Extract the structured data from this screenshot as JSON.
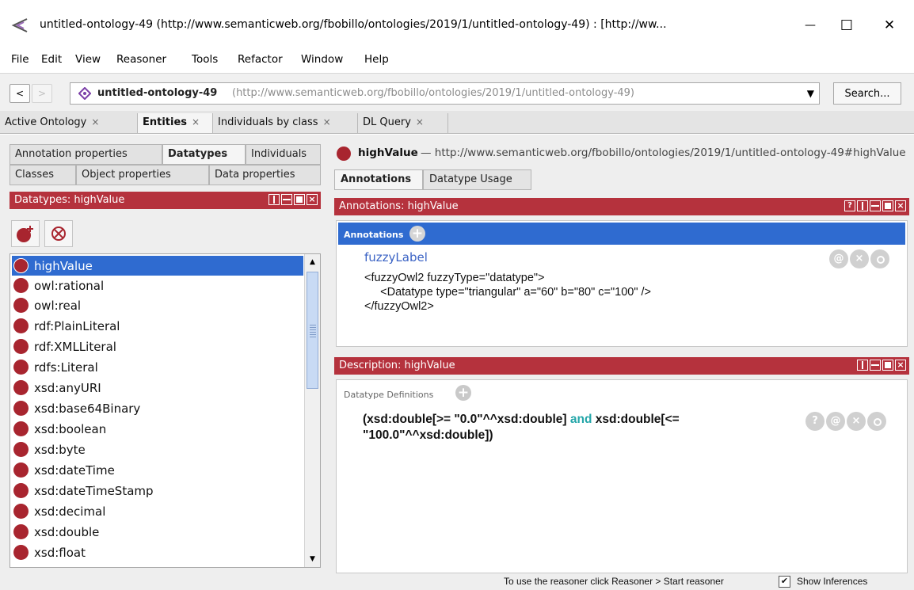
{
  "window": {
    "title": "untitled-ontology-49 (http://www.semanticweb.org/fbobillo/ontologies/2019/1/untitled-ontology-49)  : [http://ww...",
    "minimize_glyph": "—",
    "maximize_glyph": "☐",
    "close_glyph": "✕"
  },
  "menu": [
    "File",
    "Edit",
    "View",
    "Reasoner",
    "Tools",
    "Refactor",
    "Window",
    "Help"
  ],
  "nav": {
    "back": "<",
    "forward": ">",
    "ontology_name": "untitled-ontology-49",
    "ontology_iri": "(http://www.semanticweb.org/fbobillo/ontologies/2019/1/untitled-ontology-49)",
    "dropdown_glyph": "▼",
    "search_label": "Search..."
  },
  "workspace_tabs": [
    {
      "label": "Active Ontology",
      "close": "×",
      "active": false
    },
    {
      "label": "Entities",
      "close": "×",
      "active": true
    },
    {
      "label": "Individuals by class",
      "close": "×",
      "active": false
    },
    {
      "label": "DL Query",
      "close": "×",
      "active": false
    }
  ],
  "entity_tabs": {
    "row1": [
      "Annotation properties",
      "Datatypes",
      "Individuals"
    ],
    "row2": [
      "Classes",
      "Object properties",
      "Data properties"
    ],
    "active": "Datatypes"
  },
  "datatypes_view": {
    "title": "Datatypes: highValue",
    "items": [
      "highValue",
      "owl:rational",
      "owl:real",
      "rdf:PlainLiteral",
      "rdf:XMLLiteral",
      "rdfs:Literal",
      "xsd:anyURI",
      "xsd:base64Binary",
      "xsd:boolean",
      "xsd:byte",
      "xsd:dateTime",
      "xsd:dateTimeStamp",
      "xsd:decimal",
      "xsd:double",
      "xsd:float"
    ],
    "selected": "highValue",
    "scroll_up": "▲",
    "scroll_down": "▼"
  },
  "entity_header": {
    "name": "highValue",
    "iri": "— http://www.semanticweb.org/fbobillo/ontologies/2019/1/untitled-ontology-49#highValue"
  },
  "right_tabs": [
    {
      "label": "Annotations",
      "active": true
    },
    {
      "label": "Datatype Usage",
      "active": false
    }
  ],
  "annotations_view": {
    "title": "Annotations: highValue",
    "header_label": "Annotations",
    "property": "fuzzyLabel",
    "value": "<fuzzyOwl2 fuzzyType=\"datatype\">\n     <Datatype type=\"triangular\" a=\"60\" b=\"80\" c=\"100\" />\n</fuzzyOwl2>",
    "actions": [
      "@",
      "×",
      "o"
    ]
  },
  "description_view": {
    "title": "Description: highValue",
    "section_label": "Datatype Definitions",
    "expr_part1": "(xsd:double[>= \"0.0\"^^xsd:double] ",
    "expr_keyword": "and",
    "expr_part2": " xsd:double[<=",
    "expr_line2": "\"100.0\"^^xsd:double])",
    "actions": [
      "?",
      "@",
      "×",
      "o"
    ]
  },
  "status": {
    "text": "To use the reasoner click Reasoner > Start reasoner",
    "show_inferences_label": "Show Inferences",
    "show_inferences_checked": "✔"
  },
  "colors": {
    "view_header": "#b5323d",
    "selection": "#2f6bd0",
    "datatype_dot": "#a8252f",
    "keyword": "#24a6a9"
  }
}
